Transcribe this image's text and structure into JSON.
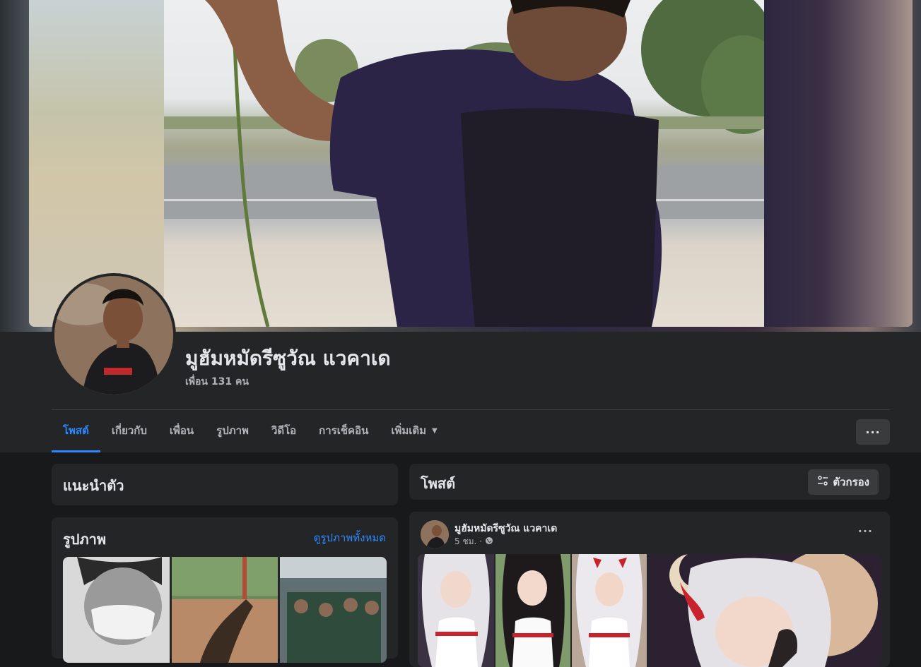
{
  "profile": {
    "name": "มูฮัมหมัดรีซูวัณ แวคาเด",
    "friends": "เพื่อน 131 คน"
  },
  "tabs": [
    {
      "label": "โพสต์"
    },
    {
      "label": "เกี่ยวกับ"
    },
    {
      "label": "เพื่อน"
    },
    {
      "label": "รูปภาพ"
    },
    {
      "label": "วิดีโอ"
    },
    {
      "label": "การเช็คอิน"
    },
    {
      "label": "เพิ่มเติม"
    }
  ],
  "more_button": "···",
  "intro": {
    "title": "แนะนำตัว"
  },
  "photos": {
    "title": "รูปภาพ",
    "see_all": "ดูรูปภาพทั้งหมด"
  },
  "posts": {
    "title": "โพสต์",
    "filter_label": "ตัวกรอง"
  },
  "post": {
    "author": "มูฮัมหมัดรีซูวัณ แวคาเด",
    "time": "5 ชม. ·",
    "more": "···"
  },
  "colors": {
    "accent": "#2d88ff",
    "background": "#18191a",
    "card": "#242526",
    "button": "#3a3b3c"
  },
  "icons": [
    "chevron-down-icon",
    "filter-icon",
    "globe-icon",
    "more-horizontal-icon"
  ]
}
